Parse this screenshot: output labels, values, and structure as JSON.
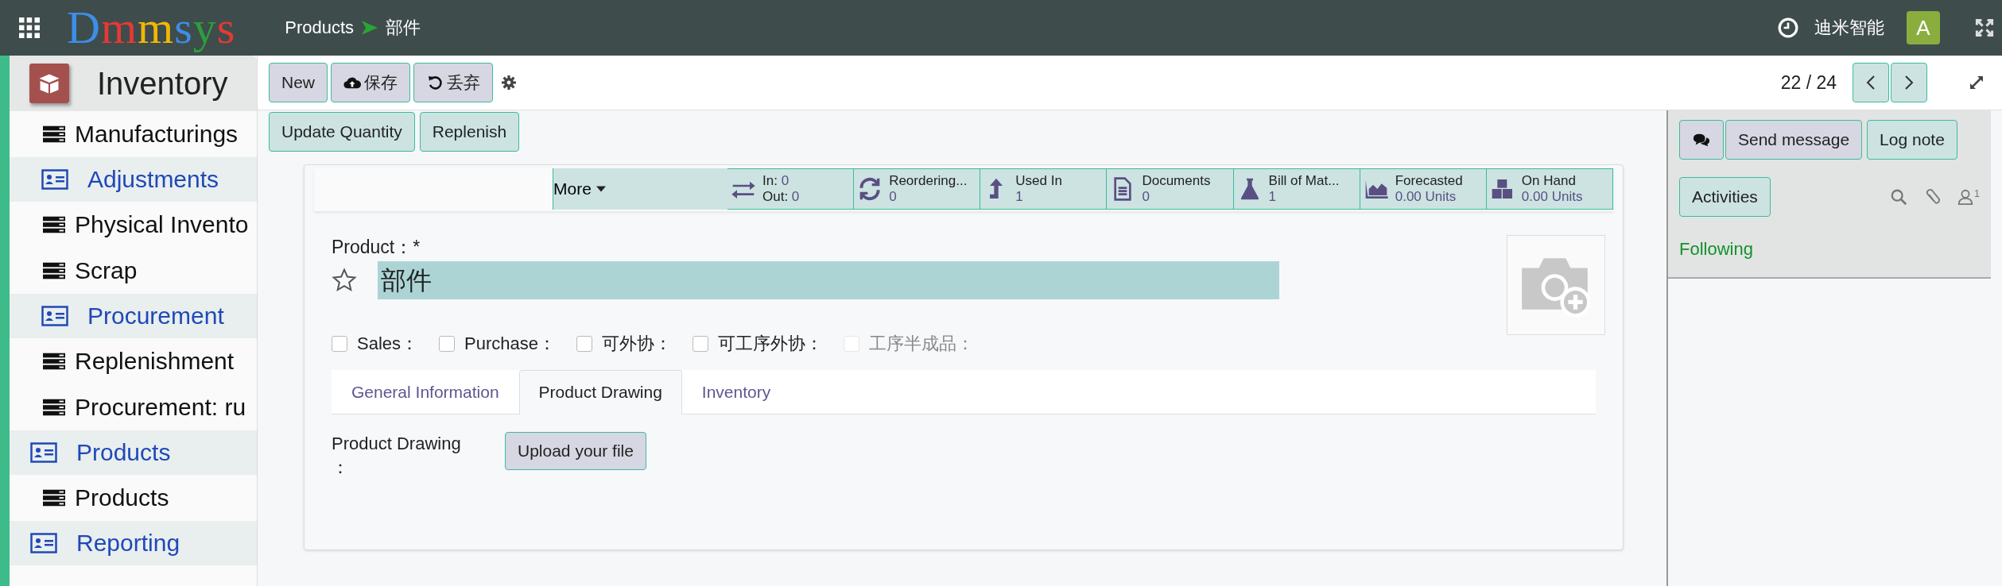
{
  "topbar": {
    "logo": "Dmmsys",
    "breadcrumb": [
      {
        "label": "Products"
      },
      {
        "label": "部件"
      }
    ],
    "company": "迪米智能",
    "avatar": "A"
  },
  "sidebar": {
    "app": "Inventory",
    "items": [
      {
        "kind": "item",
        "label": "Manufacturings"
      },
      {
        "kind": "group",
        "label": "Adjustments"
      },
      {
        "kind": "item",
        "label": "Physical Invento"
      },
      {
        "kind": "item",
        "label": "Scrap"
      },
      {
        "kind": "group",
        "label": "Procurement"
      },
      {
        "kind": "item",
        "label": "Replenishment"
      },
      {
        "kind": "item",
        "label": "Procurement: ru"
      },
      {
        "kind": "section",
        "label": "Products"
      },
      {
        "kind": "item",
        "label": "Products"
      },
      {
        "kind": "section",
        "label": "Reporting"
      }
    ]
  },
  "control_panel": {
    "buttons": [
      {
        "kind": "plain",
        "label": "New"
      },
      {
        "kind": "save",
        "label": "保存"
      },
      {
        "kind": "discard",
        "label": "丢弃"
      }
    ],
    "pager": "22 / 24",
    "actions": [
      "Update Quantity",
      "Replenish"
    ]
  },
  "stat_buttons": {
    "more": "More",
    "items": [
      {
        "kind": "inout",
        "lines": [
          {
            "label": "In:",
            "value": "0"
          },
          {
            "label": "Out:",
            "value": "0"
          }
        ]
      },
      {
        "kind": "refresh",
        "title": "Reordering...",
        "value": "0"
      },
      {
        "kind": "upload",
        "title": "Used In",
        "value": "1"
      },
      {
        "kind": "document",
        "title": "Documents",
        "value": "0"
      },
      {
        "kind": "flask",
        "title": "Bill of Mat...",
        "value": "1"
      },
      {
        "kind": "area",
        "title": "Forecasted",
        "value": "0.00 Units"
      },
      {
        "kind": "cubes",
        "title": "On Hand",
        "value": "0.00 Units"
      }
    ]
  },
  "form": {
    "name_label": "Product：*",
    "name": "部件",
    "favorite": false,
    "checkboxes": [
      {
        "label": "Sales：",
        "checked": false,
        "disabled": false
      },
      {
        "label": "Purchase：",
        "checked": false,
        "disabled": false
      },
      {
        "label": "可外协：",
        "checked": false,
        "disabled": false
      },
      {
        "label": "可工序外协：",
        "checked": false,
        "disabled": false
      },
      {
        "label": "工序半成品：",
        "checked": false,
        "disabled": true
      }
    ],
    "tabs": [
      {
        "label": "General Information",
        "selected": false
      },
      {
        "label": "Product Drawing",
        "selected": true
      },
      {
        "label": "Inventory",
        "selected": false
      }
    ],
    "drawing_label": "Product Drawing\n：",
    "upload": "Upload your file"
  },
  "chatter": {
    "send": "Send message",
    "log": "Log note",
    "activities": "Activities",
    "followers": "1",
    "following": "Following"
  }
}
